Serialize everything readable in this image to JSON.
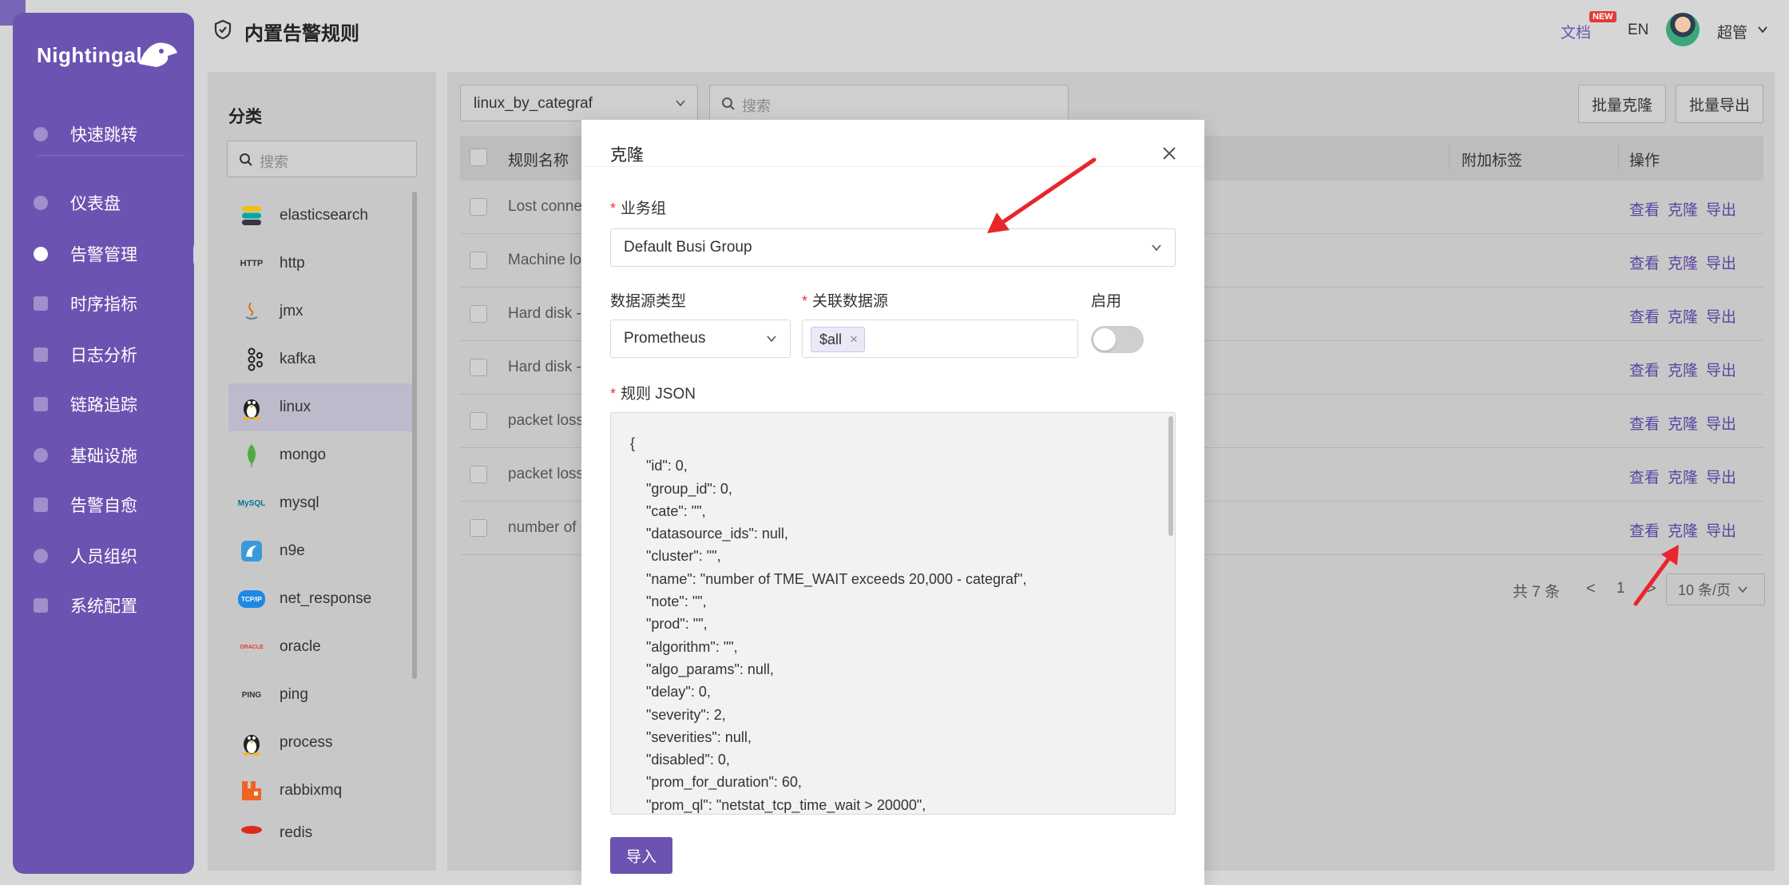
{
  "sidebar": {
    "logo": "Nightingale",
    "items": [
      {
        "label": "快速跳转",
        "icon": "search-icon"
      },
      {
        "label": "仪表盘",
        "icon": "dashboard-icon"
      },
      {
        "label": "告警管理",
        "icon": "alarm-icon"
      },
      {
        "label": "时序指标",
        "icon": "chart-icon"
      },
      {
        "label": "日志分析",
        "icon": "log-icon"
      },
      {
        "label": "链路追踪",
        "icon": "link-icon"
      },
      {
        "label": "基础设施",
        "icon": "target-icon"
      },
      {
        "label": "告警自愈",
        "icon": "terminal-icon"
      },
      {
        "label": "人员组织",
        "icon": "user-icon"
      },
      {
        "label": "系统配置",
        "icon": "grid-icon"
      }
    ]
  },
  "header": {
    "title": "内置告警规则",
    "docs": "文档",
    "new_badge": "NEW",
    "lang": "EN",
    "user": "超管"
  },
  "categories": {
    "title": "分类",
    "search_placeholder": "搜索",
    "items": [
      {
        "label": "elasticsearch"
      },
      {
        "label": "http",
        "icon_text": "HTTP"
      },
      {
        "label": "jmx"
      },
      {
        "label": "kafka"
      },
      {
        "label": "linux"
      },
      {
        "label": "mongo"
      },
      {
        "label": "mysql",
        "icon_text": "MySQL"
      },
      {
        "label": "n9e"
      },
      {
        "label": "net_response",
        "icon_text": "TCP/IP"
      },
      {
        "label": "oracle",
        "icon_text": "ORACLE"
      },
      {
        "label": "ping",
        "icon_text": "PING"
      },
      {
        "label": "process"
      },
      {
        "label": "rabbixmq"
      },
      {
        "label": "redis"
      }
    ]
  },
  "main": {
    "datasource": "linux_by_categraf",
    "search_placeholder": "搜索",
    "batch_clone": "批量克隆",
    "batch_export": "批量导出",
    "columns": {
      "name": "规则名称",
      "tags": "附加标签",
      "ops": "操作"
    },
    "rows": [
      {
        "name": "Lost conne"
      },
      {
        "name": "Machine lo"
      },
      {
        "name": "Hard disk -"
      },
      {
        "name": "Hard disk -"
      },
      {
        "name": "packet loss"
      },
      {
        "name": "packet loss"
      },
      {
        "name": "number of"
      }
    ],
    "actions": {
      "view": "查看",
      "clone": "克隆",
      "export": "导出"
    },
    "pager": {
      "total": "共 7 条",
      "prev": "<",
      "page": "1",
      "next": ">",
      "size": "10 条/页"
    }
  },
  "modal": {
    "title": "克隆",
    "busi_label": "业务组",
    "busi_value": "Default Busi Group",
    "dstype_label": "数据源类型",
    "dstype_value": "Prometheus",
    "ds_label": "关联数据源",
    "ds_tag": "$all",
    "enable_label": "启用",
    "enabled": false,
    "json_label": "规则 JSON",
    "json_text": "{\n    \"id\": 0,\n    \"group_id\": 0,\n    \"cate\": \"\",\n    \"datasource_ids\": null,\n    \"cluster\": \"\",\n    \"name\": \"number of TME_WAIT exceeds 20,000 - categraf\",\n    \"note\": \"\",\n    \"prod\": \"\",\n    \"algorithm\": \"\",\n    \"algo_params\": null,\n    \"delay\": 0,\n    \"severity\": 2,\n    \"severities\": null,\n    \"disabled\": 0,\n    \"prom_for_duration\": 60,\n    \"prom_ql\": \"netstat_tcp_time_wait > 20000\",",
    "import_button": "导入"
  },
  "colors": {
    "brand": "#6c53b1",
    "arrow": "#e8262b"
  }
}
